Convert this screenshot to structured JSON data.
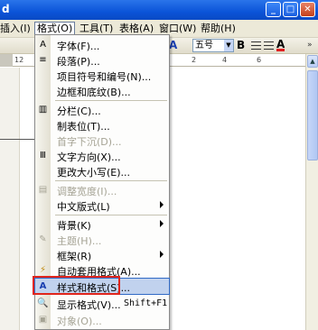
{
  "window": {
    "title_fragment": "d"
  },
  "menubar": {
    "items": [
      {
        "label": "插入(I)",
        "active": false
      },
      {
        "label": "格式(O)",
        "active": true
      },
      {
        "label": "工具(T)",
        "active": false
      },
      {
        "label": "表格(A)",
        "active": false
      },
      {
        "label": "窗口(W)",
        "active": false
      },
      {
        "label": "帮助(H)",
        "active": false
      }
    ]
  },
  "toolbar": {
    "font_size_value": "五号",
    "bold_label": "B",
    "font_color_label": "A",
    "font_style_label": "A",
    "more_chevron": "»"
  },
  "ruler": {
    "ticks": [
      "12",
      "2",
      "4",
      "6"
    ]
  },
  "format_menu": {
    "items": [
      {
        "label": "字体(F)...",
        "icon": "font-icon",
        "disabled": false,
        "submenu": false
      },
      {
        "label": "段落(P)...",
        "icon": "paragraph-icon",
        "disabled": false,
        "submenu": false
      },
      {
        "label": "项目符号和编号(N)...",
        "icon": "bullets-icon",
        "disabled": false,
        "submenu": false
      },
      {
        "label": "边框和底纹(B)...",
        "icon": "borders-icon",
        "disabled": false,
        "submenu": false
      },
      {
        "label": "分栏(C)...",
        "icon": "columns-icon",
        "disabled": false,
        "submenu": false
      },
      {
        "label": "制表位(T)...",
        "icon": "tabs-icon",
        "disabled": false,
        "submenu": false
      },
      {
        "label": "首字下沉(D)...",
        "icon": "dropcap-icon",
        "disabled": true,
        "submenu": false
      },
      {
        "label": "文字方向(X)...",
        "icon": "text-direction-icon",
        "disabled": false,
        "submenu": false
      },
      {
        "label": "更改大小写(E)...",
        "icon": "change-case-icon",
        "disabled": false,
        "submenu": false
      },
      {
        "label": "调整宽度(I)...",
        "icon": "fit-width-icon",
        "disabled": true,
        "submenu": false
      },
      {
        "label": "中文版式(L)",
        "icon": "asian-layout-icon",
        "disabled": false,
        "submenu": true
      },
      {
        "label": "背景(K)",
        "icon": "background-icon",
        "disabled": false,
        "submenu": true
      },
      {
        "label": "主题(H)...",
        "icon": "theme-icon",
        "disabled": true,
        "submenu": false
      },
      {
        "label": "框架(R)",
        "icon": "frames-icon",
        "disabled": false,
        "submenu": true
      },
      {
        "label": "自动套用格式(A)...",
        "icon": "autoformat-icon",
        "disabled": false,
        "submenu": false
      },
      {
        "label": "样式和格式(S)...",
        "icon": "styles-icon",
        "disabled": false,
        "submenu": false,
        "highlighted": true
      },
      {
        "label": "显示格式(V)...",
        "icon": "reveal-formatting-icon",
        "disabled": false,
        "submenu": false,
        "shortcut": "Shift+F1"
      },
      {
        "label": "对象(O)...",
        "icon": "object-icon",
        "disabled": true,
        "submenu": false
      }
    ]
  },
  "colors": {
    "highlight_border": "#e0251c",
    "title_bar": "#0b54d8"
  }
}
